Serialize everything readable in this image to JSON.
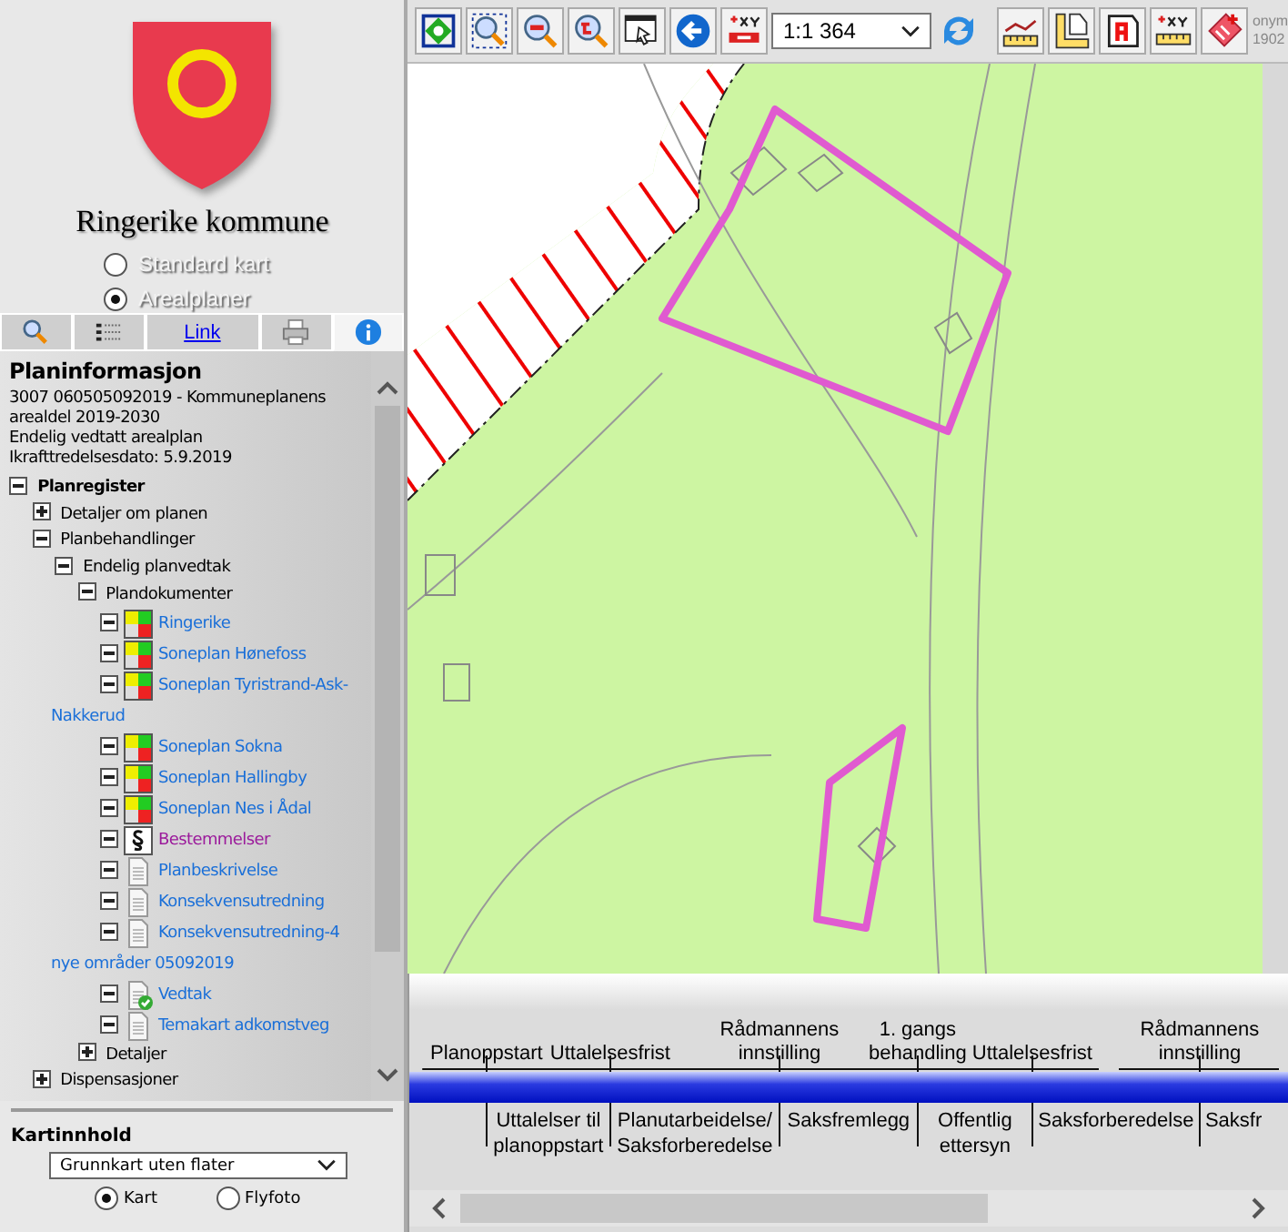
{
  "logo": {
    "title": "Ringerike kommune"
  },
  "map_type_options": [
    {
      "label": "Standard kart",
      "selected": false
    },
    {
      "label": "Arealplaner",
      "selected": true
    }
  ],
  "tabs": [
    {
      "kind": "search",
      "selected": false
    },
    {
      "kind": "legend",
      "selected": false
    },
    {
      "kind": "link",
      "label": "Link",
      "selected": false
    },
    {
      "kind": "print",
      "selected": false
    },
    {
      "kind": "info",
      "selected": true
    }
  ],
  "info": {
    "title": "Planinformasjon",
    "lines": [
      "3007 060505092019 - Kommuneplanens arealdel 2019-2030",
      "Endelig vedtatt arealplan",
      "Ikrafttredelsesdato: 5.9.2019"
    ]
  },
  "tree": [
    {
      "label": "Planregister",
      "kind": "folder",
      "expanded": true,
      "children": [
        {
          "label": "Detaljer om planen",
          "kind": "folder",
          "expanded": false
        },
        {
          "label": "Planbehandlinger",
          "kind": "folder",
          "expanded": true,
          "children": [
            {
              "label": "Endelig planvedtak",
              "kind": "folder",
              "expanded": true,
              "children": [
                {
                  "label": "Plandokumenter",
                  "kind": "folder",
                  "expanded": true,
                  "children": [
                    {
                      "label": "Ringerike",
                      "kind": "plan",
                      "expanded": true,
                      "visited": false
                    },
                    {
                      "label": "Soneplan Hønefoss",
                      "kind": "plan",
                      "expanded": true,
                      "visited": false
                    },
                    {
                      "label": "Soneplan Tyristrand-Ask-Nakkerud",
                      "kind": "plan",
                      "expanded": true,
                      "visited": false
                    },
                    {
                      "label": "Soneplan Sokna",
                      "kind": "plan",
                      "expanded": true,
                      "visited": false
                    },
                    {
                      "label": "Soneplan Hallingby",
                      "kind": "plan",
                      "expanded": true,
                      "visited": false
                    },
                    {
                      "label": "Soneplan Nes i Ådal",
                      "kind": "plan",
                      "expanded": true,
                      "visited": false
                    },
                    {
                      "label": "Bestemmelser",
                      "kind": "rules",
                      "expanded": true,
                      "visited": true
                    },
                    {
                      "label": "Planbeskrivelse",
                      "kind": "document",
                      "expanded": true,
                      "visited": false
                    },
                    {
                      "label": "Konsekvensutredning",
                      "kind": "document",
                      "expanded": true,
                      "visited": false
                    },
                    {
                      "label": "Konsekvensutredning-4 nye områder 05092019",
                      "kind": "document",
                      "expanded": true,
                      "visited": false
                    },
                    {
                      "label": "Vedtak",
                      "kind": "approved",
                      "expanded": true,
                      "visited": false
                    },
                    {
                      "label": "Temakart adkomstveg",
                      "kind": "document",
                      "expanded": true,
                      "visited": false
                    }
                  ]
                },
                {
                  "label": "Detaljer",
                  "kind": "folder",
                  "expanded": false
                }
              ]
            }
          ]
        },
        {
          "label": "Dispensasjoner",
          "kind": "folder",
          "expanded": false
        }
      ]
    }
  ],
  "map_content": {
    "title": "Kartinnhold",
    "select_value": "Grunnkart uten flater",
    "options": [
      {
        "label": "Kart",
        "selected": true
      },
      {
        "label": "Flyfoto",
        "selected": false
      }
    ]
  },
  "toolbar": {
    "tools_left": [
      {
        "kind": "zoom-extent"
      },
      {
        "kind": "zoom-box"
      },
      {
        "kind": "zoom-out"
      },
      {
        "kind": "zoom-previous"
      },
      {
        "kind": "pan"
      },
      {
        "kind": "back"
      },
      {
        "kind": "coordinate"
      }
    ],
    "scale": "1:1 364",
    "tools_right": [
      {
        "kind": "measure-distance"
      },
      {
        "kind": "measure-area"
      },
      {
        "kind": "label"
      },
      {
        "kind": "coordinate-scale"
      },
      {
        "kind": "clear"
      }
    ]
  },
  "map_corner_text": [
    "onym",
    "1902"
  ],
  "timeline": {
    "milestones": [
      {
        "label": "Planoppstart"
      },
      {
        "label": "Uttalelsesfrist"
      },
      {
        "label": "Rådmannens innstilling"
      },
      {
        "label": "1. gangs behandling"
      },
      {
        "label": "Uttalelsesfrist"
      },
      {
        "label": "Rådmannens innstilling"
      }
    ],
    "phases": [
      {
        "label": "Uttalelser til planoppstart"
      },
      {
        "label": "Planutarbeidelse/ Saksforberedelse"
      },
      {
        "label": "Saksfremlegg"
      },
      {
        "label": "Offentlig ettersyn"
      },
      {
        "label": "Saksforberedelse"
      },
      {
        "label": "Saksfr"
      }
    ]
  }
}
